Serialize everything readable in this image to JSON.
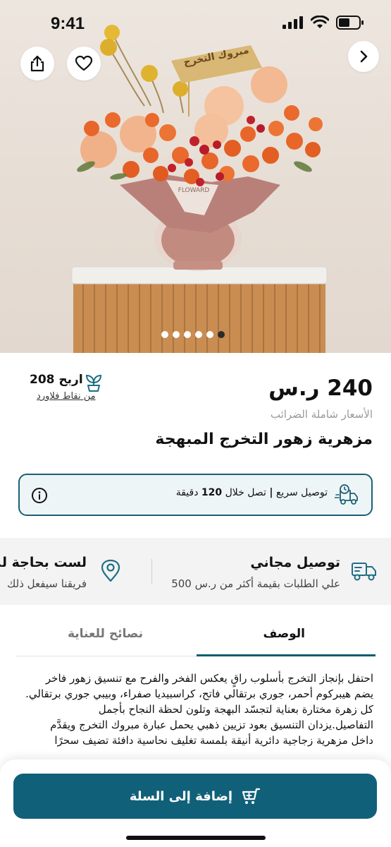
{
  "status_bar": {
    "time": "9:41"
  },
  "hero": {
    "card_text": "مبروك التخرج",
    "tag_text": "FLOWARD",
    "carousel": {
      "count": 6,
      "active_index": 5
    }
  },
  "product": {
    "price": "240 ر.س",
    "tax_note": "الأسعار شاملة الضرائب",
    "title": "مزهرية زهور التخرج المبهجة",
    "points": {
      "value": "اربح 208",
      "sub": "من نقاط فلاورد"
    }
  },
  "delivery": {
    "express": "توصيل سريع",
    "separator": "|",
    "within": "تصل خلال",
    "minutes": "120",
    "unit": "دقيقة"
  },
  "perks": [
    {
      "title": "توصيل مجاني",
      "sub": "علي الطلبات بقيمة أكثر من ر.س 500",
      "icon": "truck-icon"
    },
    {
      "title": "لست بحاجة لمعرفة العنوان",
      "sub": "فريقنا سيفعل ذلك",
      "icon": "location-pin-icon"
    }
  ],
  "tabs": [
    {
      "label": "الوصف",
      "active": true
    },
    {
      "label": "نصائح للعناية",
      "active": false
    }
  ],
  "description": [
    "احتفل بإنجاز التخرج بأسلوب راقٍ يعكس الفخر والفرح مع تنسيق زهور فاخر",
    "يضم هيبركوم أحمر، جوري برتقالي فاتح، كراسبيديا صفراء، وبيبي جوري برتقالي.",
    "كل زهرة مختارة بعناية لتجسّد البهجة وتلون لحظة النجاح بأجمل",
    "التفاصيل.يزدان التنسيق بعود تزيين ذهبي يحمل عبارة مبروك التخرج ويقدَّم",
    "داخل مزهرية زجاجية دائرية أنيقة بلمسة تغليف نحاسية دافئة تضيف سحرًا"
  ],
  "cta": {
    "label": "إضافة إلى السلة"
  },
  "colors": {
    "brand": "#11607a",
    "accent_border": "#1e5f74",
    "orange_rose": "#e8662a",
    "peach_rose": "#f2b48c"
  },
  "icons": [
    "share-icon",
    "heart-icon",
    "chevron-right-icon",
    "plant-icon",
    "info-icon",
    "fast-delivery-icon",
    "cart-plus-icon"
  ]
}
